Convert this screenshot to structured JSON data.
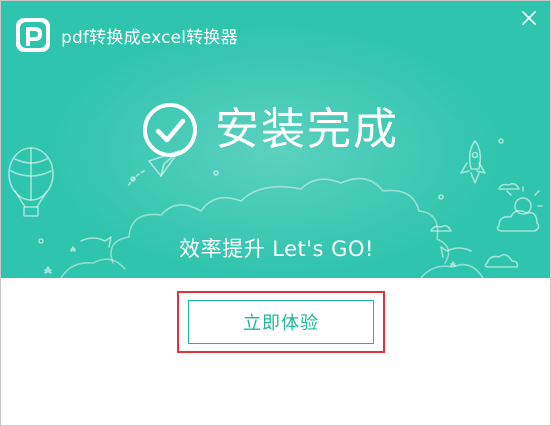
{
  "app": {
    "title": "pdf转换成excel转换器",
    "logo_icon": "pdf-logo-icon"
  },
  "window_controls": {
    "close_icon": "close-icon"
  },
  "hero": {
    "status_text": "安装完成",
    "status_icon": "check-circle-icon",
    "slogan": "效率提升 Let's GO!",
    "background_color": "#2ec4ad"
  },
  "actions": {
    "start_button_label": "立即体验",
    "accent_color": "#1fb79c",
    "highlight_color": "#e2323b"
  }
}
